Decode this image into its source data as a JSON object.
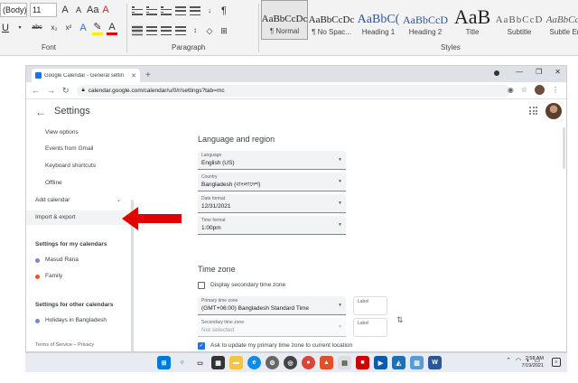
{
  "ribbon": {
    "font_name": "(Body)",
    "font_size": "11",
    "font_group_label": "Font",
    "paragraph_group_label": "Paragraph",
    "styles_group_label": "Styles",
    "styles": [
      {
        "sample": "AaBbCcDc",
        "name": "¶ Normal"
      },
      {
        "sample": "AaBbCcDc",
        "name": "¶ No Spac..."
      },
      {
        "sample": "AaBbC(",
        "name": "Heading 1"
      },
      {
        "sample": "AaBbCcD",
        "name": "Heading 2"
      },
      {
        "sample": "AaB",
        "name": "Title"
      },
      {
        "sample": "AaBbCcD",
        "name": "Subtitle"
      },
      {
        "sample": "AaBbCcD",
        "name": "Subtle Em"
      }
    ]
  },
  "browser": {
    "tab_title": "Google Calendar - General settin",
    "url": "calendar.google.com/calendar/u/0/r/settings?tab=mc"
  },
  "calendar": {
    "settings_title": "Settings",
    "sidebar": {
      "view_options": "View options",
      "events_from_gmail": "Events from Gmail",
      "keyboard_shortcuts": "Keyboard shortcuts",
      "offline": "Offline",
      "add_calendar": "Add calendar",
      "import_export": "Import & export",
      "my_calendars_heading": "Settings for my calendars",
      "my_calendars": [
        {
          "name": "Masud Rana",
          "color": "#7986cb"
        },
        {
          "name": "Family",
          "color": "#f4511e"
        }
      ],
      "other_calendars_heading": "Settings for other calendars",
      "other_calendars": [
        {
          "name": "Holidays in Bangladesh",
          "color": "#7986cb"
        }
      ],
      "footer": "Terms of Service – Privacy"
    },
    "language_region": {
      "title": "Language and region",
      "language_label": "Language",
      "language_value": "English (US)",
      "country_label": "Country",
      "country_value": "Bangladesh (বাংলাদেশ)",
      "date_format_label": "Date format",
      "date_format_value": "12/31/2021",
      "time_format_label": "Time format",
      "time_format_value": "1:00pm"
    },
    "time_zone": {
      "title": "Time zone",
      "display_secondary": "Display secondary time zone",
      "primary_label": "Primary time zone",
      "primary_value": "(GMT+06:00) Bangladesh Standard Time",
      "secondary_label": "Secondary time zone",
      "secondary_value": "Not selected",
      "label_placeholder": "Label",
      "ask_update": "Ask to update my primary time zone to current location"
    }
  },
  "taskbar": {
    "time": "2:58 AM",
    "date": "7/19/2021"
  },
  "colors": {
    "accent": "#1a73e8",
    "arrow": "#e00000"
  }
}
